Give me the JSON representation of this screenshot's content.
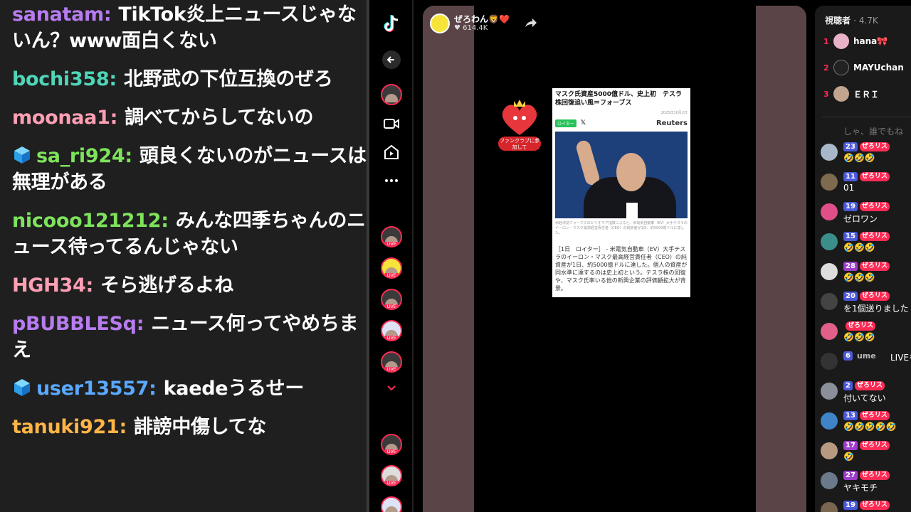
{
  "chat": [
    {
      "user": "sanatam",
      "color": "#b77cf0",
      "cube": false,
      "message": "TikTok炎上ニュースじゃないん？www面白くない"
    },
    {
      "user": "bochi358",
      "color": "#4fd6b8",
      "cube": false,
      "message": "北野武の下位互換のぜろ"
    },
    {
      "user": "moonaa1",
      "color": "#ff9fb4",
      "cube": false,
      "message": "調べてからしてないの"
    },
    {
      "user": "sa_ri924",
      "color": "#7ee35b",
      "cube": true,
      "message": "頭良くないのがニュースは無理がある"
    },
    {
      "user": "nicooo121212",
      "color": "#7ee35b",
      "cube": false,
      "message": "みんな四季ちゃんのニュース待ってるんじゃない"
    },
    {
      "user": "HGH34",
      "color": "#ff9fb4",
      "cube": false,
      "message": "そら逃げるよね"
    },
    {
      "user": "pBUBBLESq",
      "color": "#b77cf0",
      "cube": false,
      "message": "ニュース何ってやめちまえ"
    },
    {
      "user": "user13557",
      "color": "#5aa9ff",
      "cube": true,
      "message": "kaedeうるせー"
    },
    {
      "user": "tanuki921",
      "color": "#ffb547",
      "cube": false,
      "message": "誹謗中傷してな"
    }
  ],
  "chat_separator": ":",
  "stream": {
    "host_name": "ぜろわん🦁❤️",
    "host_likes": "♥ 614.4K",
    "fanclub_label": "ファンクラブに参加して",
    "news": {
      "title": "マスク氏資産5000億ドル、史上初　テスラ株回復追い風＝フォーブス",
      "meta": "2025年10月2日",
      "badge": "ロイター",
      "source": "Reuters",
      "caption": "米経済誌フォーブスのビリオネア指数によると、米電気自動車（EV）大手テスラのイーロン・マスク最高経営責任者（CEO）の純資産が1日、約5000億ドルに達した。",
      "body": "［1日　ロイター］ - 米電気自動車（EV）大手テスラのイーロン・マスク最高経営責任者（CEO）の純資産が1日、約5000億ドルに達した。個人の資産が同水準に達するのは史上初という。テスラ株の回復や、マスク氏率いる他の新興企業の評価額拡大が背景。"
    }
  },
  "viewers": {
    "label": "視聴者",
    "count": "· 4.7K",
    "top": [
      {
        "rank": "1",
        "name": "hana🎀"
      },
      {
        "rank": "2",
        "name": "MAYUchan"
      },
      {
        "rank": "3",
        "name": "ＥＲＩ"
      }
    ],
    "faded_text": "しゃ、誰でもね"
  },
  "live_comments": [
    {
      "level": "23",
      "badge": "ぜろリス",
      "message": "🤣🤣🤣",
      "emoji": true
    },
    {
      "level": "11",
      "badge": "ぜろリス",
      "message": "01",
      "emoji": false
    },
    {
      "level": "19",
      "badge": "ぜろリス",
      "message": "ゼロワン",
      "emoji": false
    },
    {
      "level": "15",
      "badge": "ぜろリス",
      "message": "🤣🤣🤣",
      "emoji": true
    },
    {
      "level": "28",
      "badge": "ぜろリス",
      "message": "🤣🤣🤣",
      "emoji": true
    },
    {
      "level": "20",
      "badge": "ぜろリス",
      "message": "を1個送りました",
      "emoji": false
    },
    {
      "level": "",
      "badge": "ぜろリス",
      "message": "🤣🤣🤣",
      "emoji": true
    },
    {
      "level": "6",
      "badge": "ume",
      "message": "LIVEを",
      "emoji": false
    },
    {
      "level": "2",
      "badge": "ぜろリス",
      "message": "付いてない",
      "emoji": false
    },
    {
      "level": "13",
      "badge": "ぜろリス",
      "message": "🤣🤣🤣🤣🤣",
      "emoji": true
    },
    {
      "level": "17",
      "badge": "ぜろリス",
      "message": "🤣",
      "emoji": true
    },
    {
      "level": "27",
      "badge": "ぜろリス",
      "message": "ヤキモチ",
      "emoji": false
    },
    {
      "level": "19",
      "badge": "ぜろリス",
      "message": "",
      "emoji": false
    }
  ]
}
